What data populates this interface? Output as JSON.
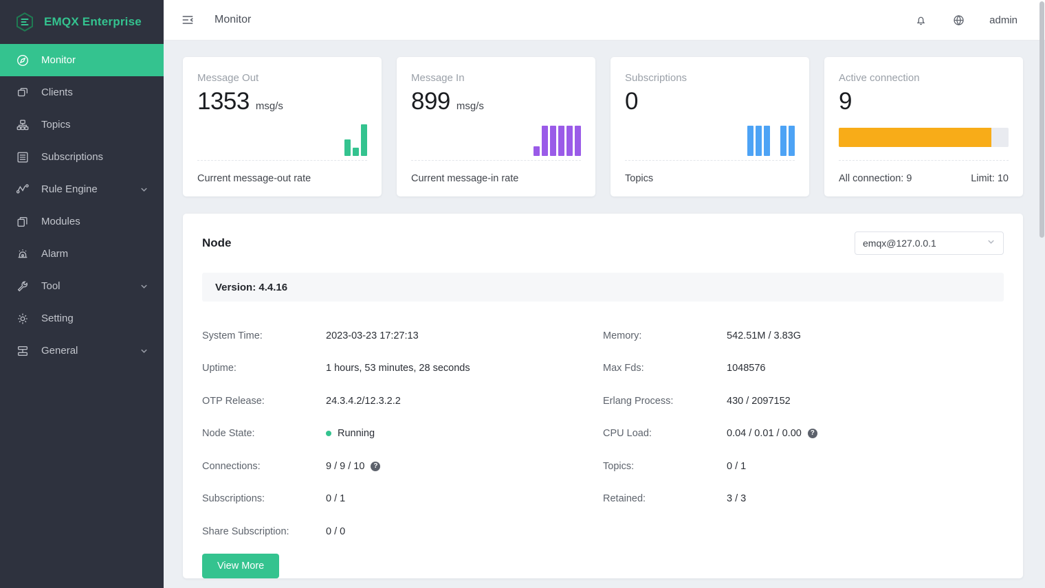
{
  "brand": {
    "name": "EMQX Enterprise",
    "logo_icon": "hexagon-logo-icon",
    "accent": "#34c38f"
  },
  "sidebar": {
    "items": [
      {
        "label": "Monitor",
        "icon": "compass-icon",
        "active": true,
        "expandable": false
      },
      {
        "label": "Clients",
        "icon": "clients-icon",
        "active": false,
        "expandable": false
      },
      {
        "label": "Topics",
        "icon": "sitemap-icon",
        "active": false,
        "expandable": false
      },
      {
        "label": "Subscriptions",
        "icon": "list-rows-icon",
        "active": false,
        "expandable": false
      },
      {
        "label": "Rule Engine",
        "icon": "nodes-graph-icon",
        "active": false,
        "expandable": true
      },
      {
        "label": "Modules",
        "icon": "stacked-cards-icon",
        "active": false,
        "expandable": false
      },
      {
        "label": "Alarm",
        "icon": "siren-icon",
        "active": false,
        "expandable": false
      },
      {
        "label": "Tool",
        "icon": "wrench-icon",
        "active": false,
        "expandable": true
      },
      {
        "label": "Setting",
        "icon": "gear-icon",
        "active": false,
        "expandable": false
      },
      {
        "label": "General",
        "icon": "server-stack-icon",
        "active": false,
        "expandable": true
      }
    ]
  },
  "topbar": {
    "menu_toggle_icon": "hamburger-collapse-icon",
    "breadcrumb": "Monitor",
    "notifications_icon": "bell-icon",
    "language_icon": "globe-icon",
    "user": "admin"
  },
  "cards": [
    {
      "title": "Message Out",
      "value": "1353",
      "unit": "msg/s",
      "footer_left": "Current message-out rate",
      "footer_right": "",
      "graph": {
        "type": "sparkline-bars",
        "color": "#34c38f",
        "bars": [
          24,
          12,
          46
        ]
      }
    },
    {
      "title": "Message In",
      "value": "899",
      "unit": "msg/s",
      "footer_left": "Current message-in rate",
      "footer_right": "",
      "graph": {
        "type": "sparkline-bars",
        "color": "#9a5be8",
        "bars": [
          14,
          44,
          44,
          44,
          44,
          44
        ]
      }
    },
    {
      "title": "Subscriptions",
      "value": "0",
      "unit": "",
      "footer_left": "Topics",
      "footer_right": "",
      "graph": {
        "type": "sparkline-bars",
        "color": "#4da3f5",
        "bars": [
          44,
          44,
          44,
          0,
          44,
          44
        ]
      }
    },
    {
      "title": "Active connection",
      "value": "9",
      "unit": "",
      "footer_left": "All connection: 9",
      "footer_right": "Limit: 10",
      "graph": {
        "type": "progress",
        "color": "#f8ac18",
        "percent": 90
      }
    }
  ],
  "node_panel": {
    "title": "Node",
    "node_select": {
      "value": "emqx@127.0.0.1",
      "chevron_icon": "chevron-down-icon"
    },
    "version_label": "Version: 4.4.16",
    "left_rows": [
      {
        "key": "System Time:",
        "value": "2023-03-23 17:27:13"
      },
      {
        "key": "Uptime:",
        "value": "1 hours, 53 minutes, 28 seconds"
      },
      {
        "key": "OTP Release:",
        "value": "24.3.4.2/12.3.2.2"
      },
      {
        "key": "Node State:",
        "value": "Running",
        "status_dot": "#34c38f"
      },
      {
        "key": "Connections:",
        "value": "9 / 9 / 10",
        "help": "?"
      },
      {
        "key": "Subscriptions:",
        "value": "0 / 1"
      },
      {
        "key": "Share Subscription:",
        "value": "0 / 0"
      }
    ],
    "right_rows": [
      {
        "key": "Memory:",
        "value": "542.51M / 3.83G"
      },
      {
        "key": "Max Fds:",
        "value": "1048576"
      },
      {
        "key": "Erlang Process:",
        "value": "430 / 2097152"
      },
      {
        "key": "CPU Load:",
        "value": "0.04 / 0.01 / 0.00",
        "help": "?"
      },
      {
        "key": "Topics:",
        "value": "0 / 1"
      },
      {
        "key": "Retained:",
        "value": "3 / 3"
      }
    ],
    "view_more_label": "View More"
  }
}
